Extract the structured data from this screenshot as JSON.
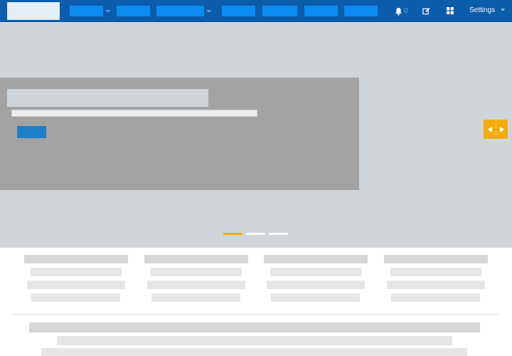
{
  "header": {
    "notifications": {
      "count": "0"
    },
    "settings_label": "Settings",
    "icons": [
      "bell-icon",
      "edit-icon",
      "apps-grid-icon",
      "chevron-down-icon"
    ]
  },
  "carousel": {
    "slides": 3,
    "active_slide": 1,
    "icons": [
      "chevron-left-icon",
      "chevron-right-icon"
    ]
  },
  "colors": {
    "nav_bg": "#0b5cab",
    "nav_pill": "#0a8cf0",
    "hero_bg": "#d0d5d9",
    "slide_card": "#a3a3a3",
    "cta_button": "#1e7fc7",
    "accent": "#f5ac0a"
  }
}
